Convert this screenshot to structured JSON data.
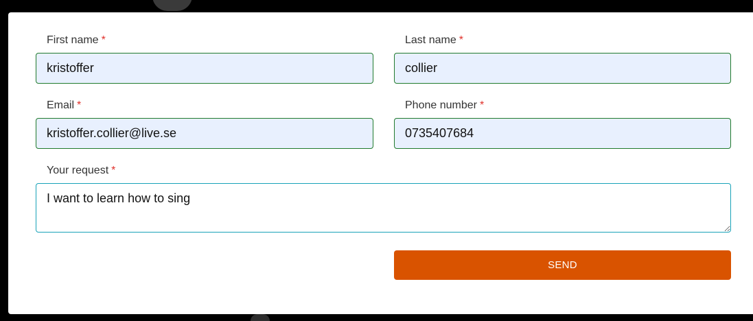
{
  "form": {
    "first_name": {
      "label": "First name",
      "required_mark": "*",
      "value": "kristoffer"
    },
    "last_name": {
      "label": "Last name",
      "required_mark": "*",
      "value": "collier"
    },
    "email": {
      "label": "Email",
      "required_mark": "*",
      "value": "kristoffer.collier@live.se"
    },
    "phone": {
      "label": "Phone number",
      "required_mark": "*",
      "value": "0735407684"
    },
    "request": {
      "label": "Your request",
      "required_mark": "*",
      "value": "I want to learn how to sing"
    },
    "send_label": "SEND"
  },
  "colors": {
    "accent_button": "#d95300",
    "valid_border": "#1f7a2c",
    "focus_border": "#17a2b8",
    "autofill_bg": "#e8f0fe",
    "required_mark": "#e0312b"
  }
}
